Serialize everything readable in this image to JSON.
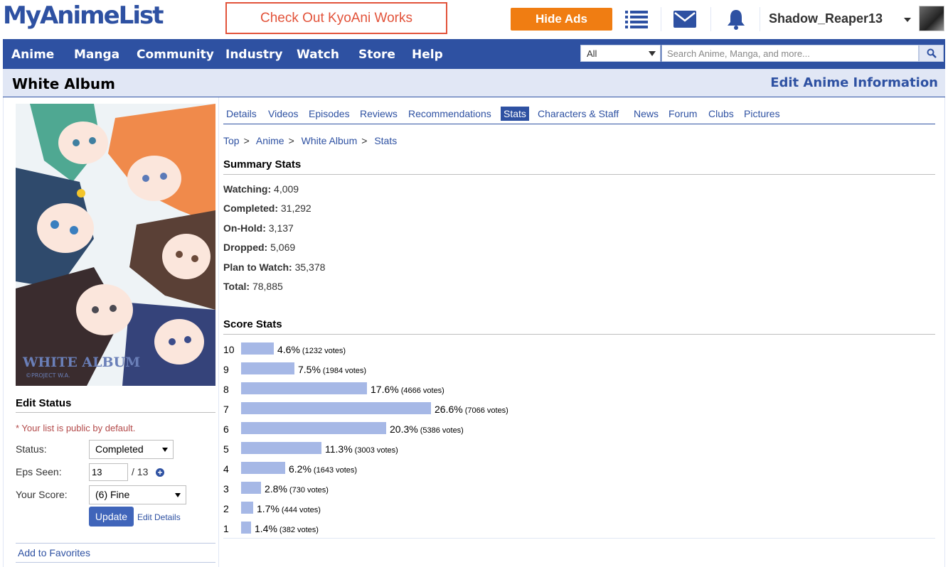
{
  "header": {
    "logo": "MyAnimeList",
    "promo": "Check Out KyoAni Works",
    "hide_ads": "Hide Ads",
    "username": "Shadow_Reaper13"
  },
  "nav": {
    "items": [
      "Anime",
      "Manga",
      "Community",
      "Industry",
      "Watch",
      "Store",
      "Help"
    ],
    "search_category": "All",
    "search_placeholder": "Search Anime, Manga, and more..."
  },
  "title_bar": {
    "title": "White Album",
    "edit_link": "Edit Anime Information"
  },
  "cover": {
    "title_text": "WHITE ALBUM",
    "copyright": "©PROJECT W.A."
  },
  "edit_status": {
    "title": "Edit Status",
    "note": "* Your list is public by default.",
    "status_label": "Status:",
    "status_value": "Completed",
    "eps_label": "Eps Seen:",
    "eps_value": "13",
    "eps_total": "/ 13",
    "score_label": "Your Score:",
    "score_value": "(6) Fine",
    "update_button": "Update",
    "edit_details": "Edit Details",
    "add_favorites": "Add to Favorites"
  },
  "tabs": [
    "Details",
    "Videos",
    "Episodes",
    "Reviews",
    "Recommendations",
    "Stats",
    "Characters & Staff",
    "News",
    "Forum",
    "Clubs",
    "Pictures"
  ],
  "active_tab": "Stats",
  "breadcrumb": [
    "Top",
    "Anime",
    "White Album",
    "Stats"
  ],
  "summary": {
    "title": "Summary Stats",
    "rows": [
      {
        "label": "Watching:",
        "value": "4,009"
      },
      {
        "label": "Completed:",
        "value": "31,292"
      },
      {
        "label": "On-Hold:",
        "value": "3,137"
      },
      {
        "label": "Dropped:",
        "value": "5,069"
      },
      {
        "label": "Plan to Watch:",
        "value": "35,378"
      },
      {
        "label": "Total:",
        "value": "78,885"
      }
    ]
  },
  "score_stats": {
    "title": "Score Stats",
    "rows": [
      {
        "score": "10",
        "percent": 4.6,
        "pct_text": "4.6%",
        "votes": "(1232 votes)"
      },
      {
        "score": "9",
        "percent": 7.5,
        "pct_text": "7.5%",
        "votes": "(1984 votes)"
      },
      {
        "score": "8",
        "percent": 17.6,
        "pct_text": "17.6%",
        "votes": "(4666 votes)"
      },
      {
        "score": "7",
        "percent": 26.6,
        "pct_text": "26.6%",
        "votes": "(7066 votes)"
      },
      {
        "score": "6",
        "percent": 20.3,
        "pct_text": "20.3%",
        "votes": "(5386 votes)"
      },
      {
        "score": "5",
        "percent": 11.3,
        "pct_text": "11.3%",
        "votes": "(3003 votes)"
      },
      {
        "score": "4",
        "percent": 6.2,
        "pct_text": "6.2%",
        "votes": "(1643 votes)"
      },
      {
        "score": "3",
        "percent": 2.8,
        "pct_text": "2.8%",
        "votes": "(730 votes)"
      },
      {
        "score": "2",
        "percent": 1.7,
        "pct_text": "1.7%",
        "votes": "(444 votes)"
      },
      {
        "score": "1",
        "percent": 1.4,
        "pct_text": "1.4%",
        "votes": "(382 votes)"
      }
    ]
  },
  "icons": {
    "list": "list-icon",
    "mail": "mail-icon",
    "bell": "bell-icon",
    "search": "search-icon"
  },
  "colors": {
    "brand": "#2e51a2",
    "hide_ads": "#f07d12",
    "promo": "#e2533a",
    "bar": "#a6b8e6"
  }
}
